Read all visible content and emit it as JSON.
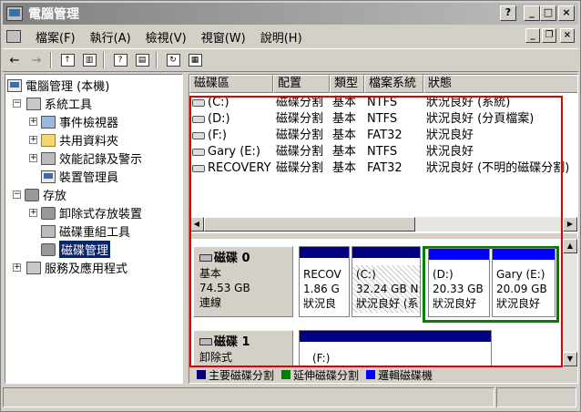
{
  "window": {
    "title": "電腦管理",
    "buttons": {
      "help": "?",
      "minimize": "_",
      "maximize": "□",
      "close": "×"
    }
  },
  "menu": {
    "items": [
      "檔案(F)",
      "執行(A)",
      "檢視(V)",
      "視窗(W)",
      "說明(H)"
    ],
    "mdi_buttons": {
      "minimize": "_",
      "restore": "❐",
      "close": "×"
    }
  },
  "tree": {
    "root": "電腦管理 (本機)",
    "system_tools": "系統工具",
    "event_viewer": "事件檢視器",
    "shared_folders": "共用資料夾",
    "perf_logs": "效能記錄及警示",
    "device_manager": "裝置管理員",
    "storage": "存放",
    "removable_storage": "卸除式存放裝置",
    "defrag": "磁碟重組工具",
    "disk_mgmt": "磁碟管理",
    "services": "服務及應用程式"
  },
  "volumes": {
    "headers": [
      "磁碟區",
      "配置",
      "類型",
      "檔案系統",
      "狀態"
    ],
    "rows": [
      {
        "name": "(C:)",
        "layout": "磁碟分割",
        "type": "基本",
        "fs": "NTFS",
        "status": "狀況良好 (系統)"
      },
      {
        "name": "(D:)",
        "layout": "磁碟分割",
        "type": "基本",
        "fs": "NTFS",
        "status": "狀況良好 (分頁檔案)"
      },
      {
        "name": "(F:)",
        "layout": "磁碟分割",
        "type": "基本",
        "fs": "FAT32",
        "status": "狀況良好"
      },
      {
        "name": "Gary (E:)",
        "layout": "磁碟分割",
        "type": "基本",
        "fs": "NTFS",
        "status": "狀況良好"
      },
      {
        "name": "RECOVERY",
        "layout": "磁碟分割",
        "type": "基本",
        "fs": "FAT32",
        "status": "狀況良好 (不明的磁碟分割)"
      }
    ]
  },
  "disks": {
    "disk0": {
      "name": "磁碟 0",
      "type": "基本",
      "size": "74.53 GB",
      "state": "連線",
      "partitions": [
        {
          "label": "RECOV",
          "size": "1.86 G",
          "status": "狀況良"
        },
        {
          "label": "(C:)",
          "size": "32.24 GB N",
          "status": "狀況良好 (系"
        },
        {
          "label": "(D:)",
          "size": "20.33 GB",
          "status": "狀況良好"
        },
        {
          "label": "Gary  (E:)",
          "size": "20.09 GB",
          "status": "狀況良好"
        }
      ]
    },
    "disk1": {
      "name": "磁碟 1",
      "type": "卸除式",
      "partition": {
        "label": "(F:)"
      }
    }
  },
  "legend": {
    "primary": "主要磁碟分割",
    "extended": "延伸磁碟分割",
    "logical": "邏輯磁碟機",
    "colors": {
      "primary": "#000080",
      "extended": "#008000",
      "logical": "#0000ff"
    }
  },
  "annotation": {
    "color": "#e00000"
  }
}
